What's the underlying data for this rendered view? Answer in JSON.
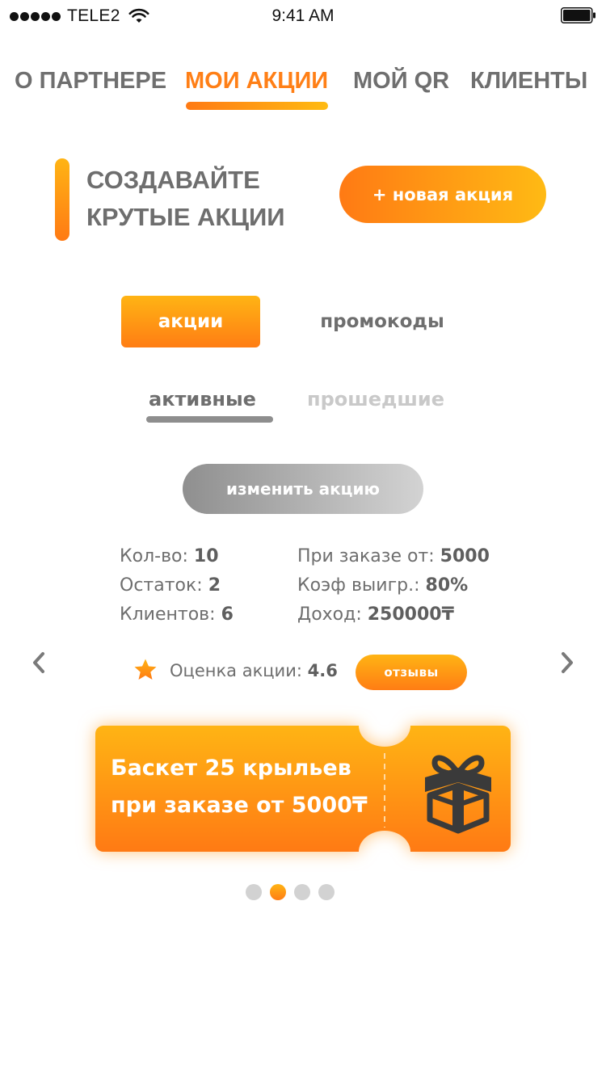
{
  "status_bar": {
    "carrier": "TELE2",
    "time": "9:41 AM"
  },
  "top_tabs": [
    {
      "label": "О ПАРТНЕРЕ",
      "active": false
    },
    {
      "label": "МОИ АКЦИИ",
      "active": true
    },
    {
      "label": "МОЙ QR",
      "active": false
    },
    {
      "label": "КЛИЕНТЫ",
      "active": false
    }
  ],
  "hero": {
    "title_line1": "СОЗДАВАЙТЕ",
    "title_line2": "КРУТЫЕ АКЦИИ",
    "new_button": "+ новая акция"
  },
  "segment": {
    "promotions": "акции",
    "promocodes": "промокоды"
  },
  "subtabs": {
    "active": "активные",
    "past": "прошедшие"
  },
  "edit_button": "изменить акцию",
  "stats": {
    "quantity_label": "Кол-во:",
    "quantity_value": "10",
    "remaining_label": "Остаток:",
    "remaining_value": "2",
    "clients_label": "Клиентов:",
    "clients_value": "6",
    "min_order_label": "При заказе от:",
    "min_order_value": "5000",
    "win_coef_label": "Коэф выигр.:",
    "win_coef_value": "80%",
    "income_label": "Доход:",
    "income_value": "250000₸"
  },
  "rating": {
    "label": "Оценка акции:",
    "value": "4.6",
    "reviews_button": "отзывы"
  },
  "ticket": {
    "line1": "Баскет 25 крыльев",
    "line2": "при заказе от 5000₸"
  },
  "pagination": {
    "total": 4,
    "active_index": 1
  },
  "colors": {
    "accent_start": "#ff7a14",
    "accent_end": "#ffba14",
    "text_gray": "#6e6e6e",
    "inactive_gray": "#c9c9c9"
  },
  "icons": {
    "signal": "signal-dots-icon",
    "wifi": "wifi-icon",
    "battery": "battery-icon",
    "star": "star-icon",
    "gift": "gift-icon",
    "prev": "chevron-left-icon",
    "next": "chevron-right-icon"
  }
}
